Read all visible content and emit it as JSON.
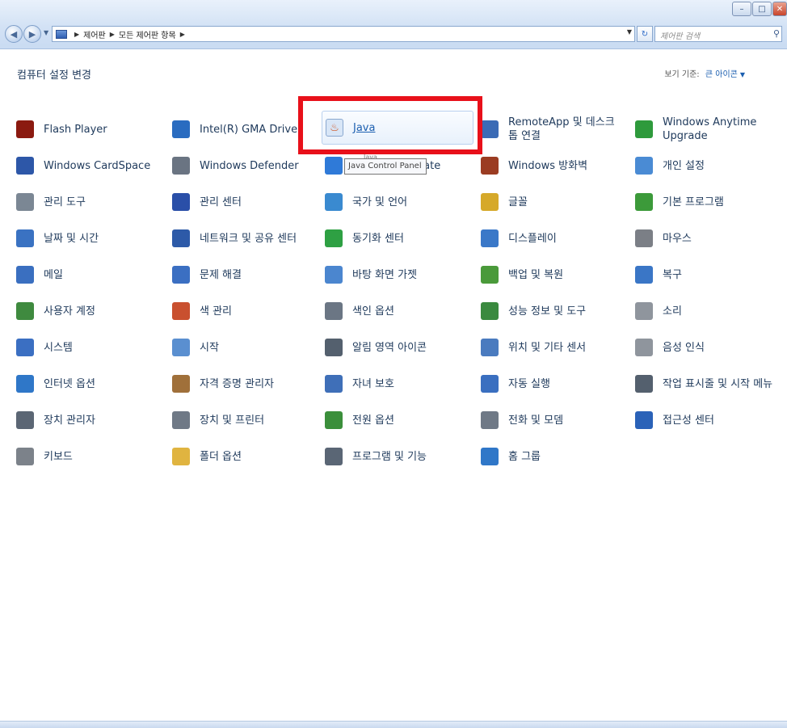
{
  "window": {
    "minimize_glyph": "–",
    "maximize_glyph": "□",
    "close_glyph": "✕"
  },
  "nav": {
    "breadcrumb": [
      "제어판",
      "모든 제어판 항목"
    ],
    "search_placeholder": "제어판 검색"
  },
  "header": {
    "title": "컴퓨터 설정 변경",
    "view_by_label": "보기 기준:",
    "view_by_value": "큰 아이콘"
  },
  "items": [
    {
      "label": "Flash Player",
      "icon": "flash-player-icon",
      "color": "#8b1a10"
    },
    {
      "label": "Intel(R) GMA Driver",
      "icon": "intel-gma-icon",
      "color": "#2a6cc0"
    },
    {
      "label": "Java",
      "icon": "java-icon",
      "color": "#d8e6f7"
    },
    {
      "label": "RemoteApp 및 데스크톱 연결",
      "icon": "remoteapp-icon",
      "color": "#3b6bb5"
    },
    {
      "label": "Windows Anytime Upgrade",
      "icon": "windows-anytime-upgrade-icon",
      "color": "#2e9a3c"
    },
    {
      "label": "Windows CardSpace",
      "icon": "cardspace-icon",
      "color": "#2d57a8"
    },
    {
      "label": "Windows Defender",
      "icon": "defender-icon",
      "color": "#6a7482"
    },
    {
      "label": "Windows Update",
      "icon": "windows-update-icon",
      "color": "#2f7ad8"
    },
    {
      "label": "Windows 방화벽",
      "icon": "firewall-icon",
      "color": "#9b3c22"
    },
    {
      "label": "개인 설정",
      "icon": "personalization-icon",
      "color": "#4a8bd4"
    },
    {
      "label": "관리 도구",
      "icon": "admin-tools-icon",
      "color": "#7b8794"
    },
    {
      "label": "관리 센터",
      "icon": "action-center-icon",
      "color": "#2a4fa8"
    },
    {
      "label": "국가 및 언어",
      "icon": "region-language-icon",
      "color": "#3a8ad0"
    },
    {
      "label": "글꼴",
      "icon": "fonts-icon",
      "color": "#d6a92a"
    },
    {
      "label": "기본 프로그램",
      "icon": "default-programs-icon",
      "color": "#3c9a3a"
    },
    {
      "label": "날짜 및 시간",
      "icon": "date-time-icon",
      "color": "#3a72c2"
    },
    {
      "label": "네트워크 및 공유 센터",
      "icon": "network-sharing-icon",
      "color": "#2d5aa8"
    },
    {
      "label": "동기화 센터",
      "icon": "sync-center-icon",
      "color": "#2ea043"
    },
    {
      "label": "디스플레이",
      "icon": "display-icon",
      "color": "#3a78c8"
    },
    {
      "label": "마우스",
      "icon": "mouse-icon",
      "color": "#7b7f86"
    },
    {
      "label": "메일",
      "icon": "mail-icon",
      "color": "#3a6fc0"
    },
    {
      "label": "문제 해결",
      "icon": "troubleshooting-icon",
      "color": "#3b6fc2"
    },
    {
      "label": "바탕 화면 가젯",
      "icon": "gadgets-icon",
      "color": "#4b86cf"
    },
    {
      "label": "백업 및 복원",
      "icon": "backup-restore-icon",
      "color": "#4a9a3a"
    },
    {
      "label": "복구",
      "icon": "recovery-icon",
      "color": "#3a76c6"
    },
    {
      "label": "사용자 계정",
      "icon": "user-accounts-icon",
      "color": "#3f8a3f"
    },
    {
      "label": "색 관리",
      "icon": "color-management-icon",
      "color": "#c9502f"
    },
    {
      "label": "색인 옵션",
      "icon": "indexing-options-icon",
      "color": "#6b7684"
    },
    {
      "label": "성능 정보 및 도구",
      "icon": "performance-icon",
      "color": "#3a8a3f"
    },
    {
      "label": "소리",
      "icon": "sound-icon",
      "color": "#8f959d"
    },
    {
      "label": "시스템",
      "icon": "system-icon",
      "color": "#3b6fc2"
    },
    {
      "label": "시작",
      "icon": "getting-started-icon",
      "color": "#5a8fd0"
    },
    {
      "label": "알림 영역 아이콘",
      "icon": "notification-area-icon",
      "color": "#54606e"
    },
    {
      "label": "위치 및 기타 센서",
      "icon": "location-sensors-icon",
      "color": "#4a7bbf"
    },
    {
      "label": "음성 인식",
      "icon": "speech-recognition-icon",
      "color": "#8f959d"
    },
    {
      "label": "인터넷 옵션",
      "icon": "internet-options-icon",
      "color": "#2f77c8"
    },
    {
      "label": "자격 증명 관리자",
      "icon": "credential-manager-icon",
      "color": "#a0703a"
    },
    {
      "label": "자녀 보호",
      "icon": "parental-controls-icon",
      "color": "#3f6fb8"
    },
    {
      "label": "자동 실행",
      "icon": "autoplay-icon",
      "color": "#3a6fc0"
    },
    {
      "label": "작업 표시줄 및 시작 메뉴",
      "icon": "taskbar-start-menu-icon",
      "color": "#54606e"
    },
    {
      "label": "장치 관리자",
      "icon": "device-manager-icon",
      "color": "#5b6674"
    },
    {
      "label": "장치 및 프린터",
      "icon": "devices-printers-icon",
      "color": "#6f7986"
    },
    {
      "label": "전원 옵션",
      "icon": "power-options-icon",
      "color": "#3b8f3b"
    },
    {
      "label": "전화 및 모뎀",
      "icon": "phone-modem-icon",
      "color": "#6f7986"
    },
    {
      "label": "접근성 센터",
      "icon": "ease-of-access-icon",
      "color": "#2a62b8"
    },
    {
      "label": "키보드",
      "icon": "keyboard-icon",
      "color": "#7c828a"
    },
    {
      "label": "폴더 옵션",
      "icon": "folder-options-icon",
      "color": "#e0b440"
    },
    {
      "label": "프로그램 및 기능",
      "icon": "programs-features-icon",
      "color": "#5a6675"
    },
    {
      "label": "홈 그룹",
      "icon": "homegroup-icon",
      "color": "#2f77c8"
    }
  ],
  "tooltip": {
    "title": "Java",
    "text": "Java Control Panel"
  },
  "highlight_color": "#e8101a"
}
